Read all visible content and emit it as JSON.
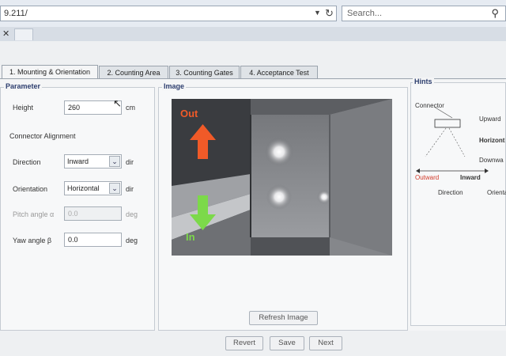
{
  "browser": {
    "url": "9.211/",
    "search_placeholder": "Search..."
  },
  "tabs": [
    {
      "label": "1. Mounting & Orientation"
    },
    {
      "label": "2. Counting Area"
    },
    {
      "label": "3. Counting Gates"
    },
    {
      "label": "4. Acceptance Test"
    }
  ],
  "parameter": {
    "title": "Parameter",
    "height_label": "Height",
    "height_value": "260",
    "height_unit": "cm",
    "connector_label": "Connector Alignment",
    "direction_label": "Direction",
    "direction_value": "Inward",
    "direction_unit": "dir",
    "orientation_label": "Orientation",
    "orientation_value": "Horizontal",
    "orientation_unit": "dir",
    "pitch_label": "Pitch angle α",
    "pitch_placeholder": "0.0",
    "pitch_unit": "deg",
    "yaw_label": "Yaw angle β",
    "yaw_value": "0.0",
    "yaw_unit": "deg"
  },
  "image_panel": {
    "title": "Image",
    "out_label": "Out",
    "in_label": "In",
    "refresh_button": "Refresh Image"
  },
  "hints": {
    "title": "Hints",
    "connector": "Connector",
    "upward": "Upward",
    "horizontal": "Horizont",
    "downward": "Downwa",
    "outward": "Outward",
    "inward": "Inward",
    "direction": "Direction",
    "orientation": "Orienta"
  },
  "footer": {
    "revert": "Revert",
    "save": "Save",
    "next": "Next"
  },
  "colors": {
    "out_arrow": "#f05a28",
    "in_arrow": "#7cd94a",
    "outward": "#d23a2a",
    "accent_title": "#2d3e6e"
  }
}
